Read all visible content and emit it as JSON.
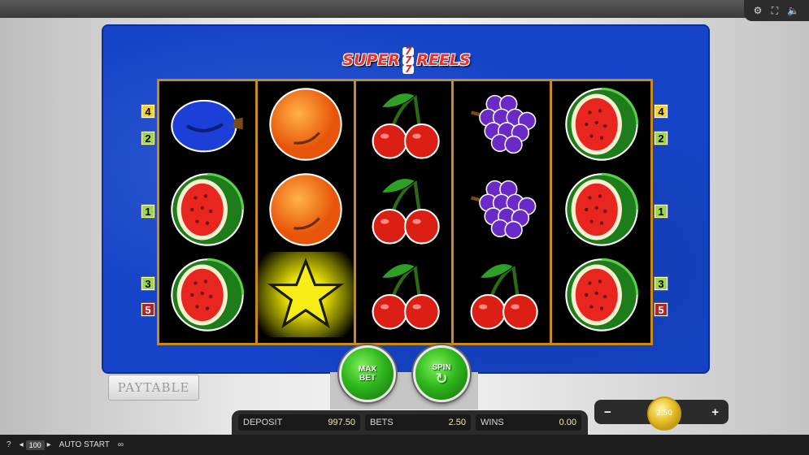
{
  "window_icons": {
    "settings": "⚙",
    "fullscreen": "⛶",
    "sound": "🔈"
  },
  "logo": {
    "left_word": "SUPER",
    "sevens": [
      "7",
      "7",
      "7"
    ],
    "right_word": "REELS"
  },
  "reels": [
    [
      "plum",
      "watermelon",
      "watermelon"
    ],
    [
      "orange",
      "orange",
      "star"
    ],
    [
      "cherry",
      "cherry",
      "cherry"
    ],
    [
      "grapes",
      "grapes",
      "cherry"
    ],
    [
      "watermelon",
      "watermelon",
      "watermelon"
    ]
  ],
  "line_indicators_left": [
    "4",
    "2",
    "1",
    "3",
    "5"
  ],
  "line_indicators_right": [
    "4",
    "2",
    "1",
    "3",
    "5"
  ],
  "buttons": {
    "paytable": "PAYTABLE",
    "max_bet_line1": "MAX",
    "max_bet_line2": "BET",
    "spin": "SPIN"
  },
  "stats": {
    "deposit_label": "DEPOSIT",
    "deposit_value": "997.50",
    "bets_label": "BETS",
    "bets_value": "2.50",
    "wins_label": "WINS",
    "wins_value": "0.00"
  },
  "bet_control": {
    "minus": "−",
    "plus": "+",
    "coin_value": "2.50"
  },
  "statusbar": {
    "help": "?",
    "speed_value": "100",
    "auto_start": "AUTO START",
    "infinity": "∞"
  }
}
